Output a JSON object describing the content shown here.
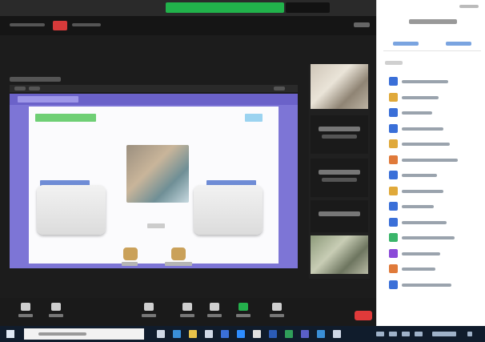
{
  "window": {},
  "colors": {
    "share_banner": "#21b24b",
    "record_chip": "#d63a3a",
    "end_button": "#e03a3a",
    "share_frame": "#7d75d6",
    "panel_bg": "#ffffff",
    "taskbar_bg": "#101c2c"
  },
  "controls": {
    "items": [
      {
        "icon": "microphone-icon"
      },
      {
        "icon": "video-camera-icon"
      },
      {
        "icon": "participants-icon"
      },
      {
        "icon": "chat-icon"
      },
      {
        "icon": "record-icon"
      },
      {
        "icon": "share-screen-icon",
        "state": "active"
      },
      {
        "icon": "reactions-icon"
      }
    ]
  },
  "participants": {
    "avatar_colors": [
      "#3a6fd8",
      "#e0a93a",
      "#3a6fd8",
      "#3a6fd8",
      "#e0a93a",
      "#e07a3a",
      "#3a6fd8",
      "#e0a93a",
      "#3a6fd8",
      "#3a6fd8",
      "#3ab56a",
      "#8a4ad8",
      "#e07a3a",
      "#3a6fd8"
    ]
  },
  "taskbar": {
    "icons": [
      "task-view-icon",
      "edge-icon",
      "file-explorer-icon",
      "store-icon",
      "mail-icon",
      "zoom-icon",
      "chrome-icon",
      "word-icon",
      "excel-icon",
      "teams-icon",
      "photos-icon",
      "settings-icon"
    ]
  }
}
